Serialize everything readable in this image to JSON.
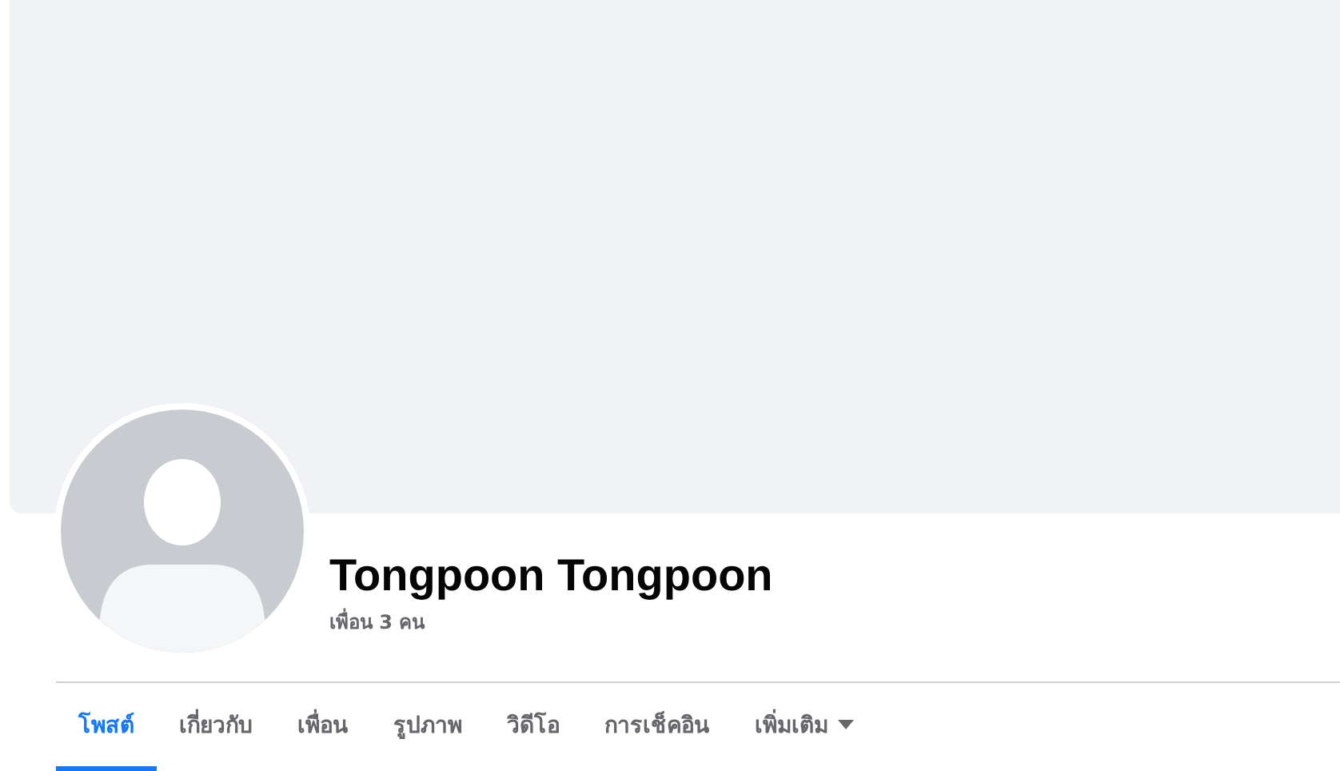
{
  "profile": {
    "name": "Tongpoon Tongpoon",
    "friends_count": "เพื่อน 3 คน"
  },
  "tabs": [
    {
      "label": "โพสต์",
      "selected": true,
      "has_dropdown": false
    },
    {
      "label": "เกี่ยวกับ",
      "selected": false,
      "has_dropdown": false
    },
    {
      "label": "เพื่อน",
      "selected": false,
      "has_dropdown": false
    },
    {
      "label": "รูปภาพ",
      "selected": false,
      "has_dropdown": false
    },
    {
      "label": "วิดีโอ",
      "selected": false,
      "has_dropdown": false
    },
    {
      "label": "การเช็คอิน",
      "selected": false,
      "has_dropdown": false
    },
    {
      "label": "เพิ่มเติม",
      "selected": false,
      "has_dropdown": true
    }
  ]
}
